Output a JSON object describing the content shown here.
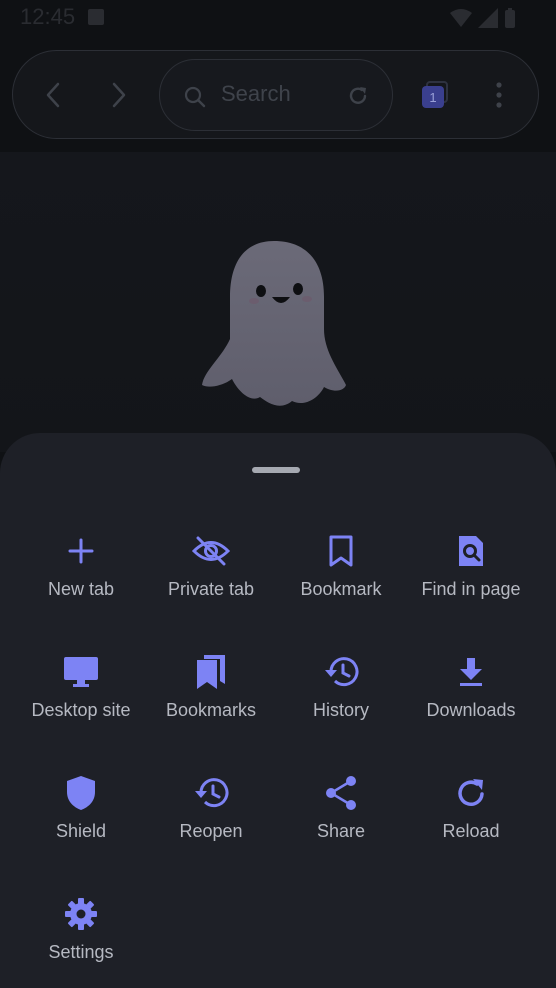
{
  "status": {
    "time": "12:45"
  },
  "toolbar": {
    "back_label": "Back",
    "forward_label": "Forward",
    "search_placeholder": "Search",
    "tab_count": "1"
  },
  "menu": {
    "items": [
      {
        "label": "New tab",
        "icon": "plus-icon"
      },
      {
        "label": "Private tab",
        "icon": "eye-off-icon"
      },
      {
        "label": "Bookmark",
        "icon": "bookmark-icon"
      },
      {
        "label": "Find in page",
        "icon": "find-in-page-icon"
      },
      {
        "label": "Desktop site",
        "icon": "monitor-icon"
      },
      {
        "label": "Bookmarks",
        "icon": "bookmarks-icon"
      },
      {
        "label": "History",
        "icon": "history-icon"
      },
      {
        "label": "Downloads",
        "icon": "download-icon"
      },
      {
        "label": "Shield",
        "icon": "shield-icon"
      },
      {
        "label": "Reopen",
        "icon": "reopen-icon"
      },
      {
        "label": "Share",
        "icon": "share-icon"
      },
      {
        "label": "Reload",
        "icon": "reload-icon"
      },
      {
        "label": "Settings",
        "icon": "gear-icon"
      }
    ]
  },
  "colors": {
    "accent": "#7d83f4",
    "sheet": "#1e2027"
  }
}
